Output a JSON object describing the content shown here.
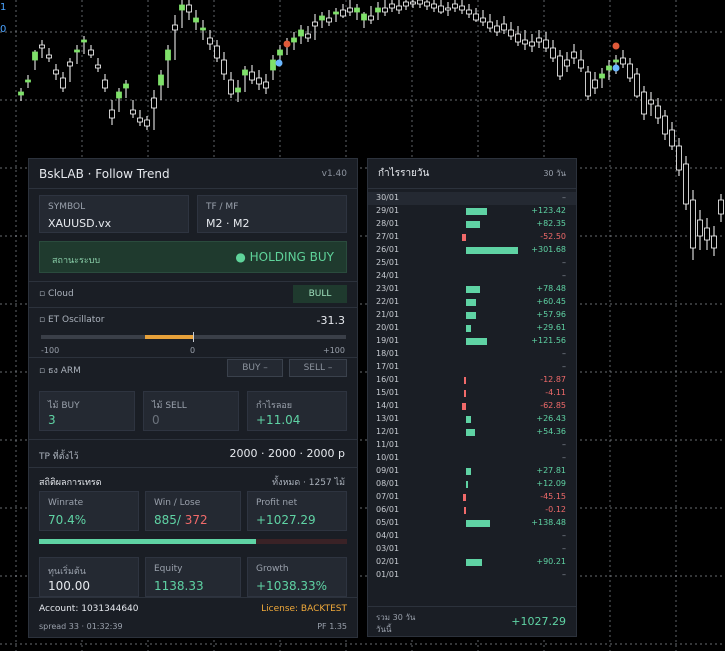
{
  "axis_tags": [
    "1",
    "0"
  ],
  "colors": {
    "bull": "#5fd3a4",
    "bear": "#f06a6a",
    "accent": "#e7a13a",
    "license": "#f0a93a"
  },
  "panel": {
    "title": "BskLAB · Follow Trend",
    "version": "v1.40",
    "symbol_label": "SYMBOL",
    "symbol_value": "XAUUSD.vx",
    "tf_label": "TF / MF",
    "tf_value": "M2 · M2",
    "status_label": "สถานะระบบ",
    "status_value": "● HOLDING BUY",
    "cloud_label": "▫ Cloud",
    "cloud_value": "BULL",
    "osc_label": "▫ ET Oscillator",
    "osc_value": "-31.3",
    "osc_level": -31.3,
    "osc_min_label": "-100",
    "osc_mid_label": "0",
    "osc_max_label": "+100",
    "arm_label": "▫ ธง ARM",
    "arm_buy": "BUY –",
    "arm_sell": "SELL –",
    "buy_label": "ไม้ BUY",
    "buy_value": "3",
    "sell_label": "ไม้ SELL",
    "sell_value": "0",
    "float_label": "กำไรลอย",
    "float_value": "+11.04",
    "tp_label": "TP ที่ตั้งไว้",
    "tp_value": "2000 · 2000 · 2000 p",
    "stats_title": "สถิติผลการเทรด",
    "stats_total": "ทั้งหมด · 1257 ไม้",
    "winrate_label": "Winrate",
    "winrate_value": "70.4%",
    "winrate_fraction": 0.704,
    "winlose_label": "Win / Lose",
    "win_value": "885/",
    "lose_value": "372",
    "profit_label": "Profit net",
    "profit_value": "+1027.29",
    "capital_label": "ทุนเริ่มต้น",
    "capital_value": "100.00",
    "equity_label": "Equity",
    "equity_value": "1138.33",
    "growth_label": "Growth",
    "growth_value": "+1038.33%",
    "account": "Account: 1031344640",
    "license": "License: BACKTEST",
    "spread": "spread 33 · 01:32:39",
    "pf": "PF 1.35"
  },
  "daily": {
    "title": "กำไรรายวัน",
    "subtitle": "30 วัน",
    "rows": [
      {
        "d": "30/01",
        "v": "–",
        "n": 0
      },
      {
        "d": "29/01",
        "v": "+123.42",
        "n": 123.42
      },
      {
        "d": "28/01",
        "v": "+82.35",
        "n": 82.35
      },
      {
        "d": "27/01",
        "v": "-52.50",
        "n": -52.5
      },
      {
        "d": "26/01",
        "v": "+301.68",
        "n": 301.68
      },
      {
        "d": "25/01",
        "v": "–",
        "n": 0
      },
      {
        "d": "24/01",
        "v": "–",
        "n": 0
      },
      {
        "d": "23/01",
        "v": "+78.48",
        "n": 78.48
      },
      {
        "d": "22/01",
        "v": "+60.45",
        "n": 60.45
      },
      {
        "d": "21/01",
        "v": "+57.96",
        "n": 57.96
      },
      {
        "d": "20/01",
        "v": "+29.61",
        "n": 29.61
      },
      {
        "d": "19/01",
        "v": "+121.56",
        "n": 121.56
      },
      {
        "d": "18/01",
        "v": "–",
        "n": 0
      },
      {
        "d": "17/01",
        "v": "–",
        "n": 0
      },
      {
        "d": "16/01",
        "v": "-12.87",
        "n": -12.87
      },
      {
        "d": "15/01",
        "v": "-4.11",
        "n": -4.11
      },
      {
        "d": "14/01",
        "v": "-62.85",
        "n": -62.85
      },
      {
        "d": "13/01",
        "v": "+26.43",
        "n": 26.43
      },
      {
        "d": "12/01",
        "v": "+54.36",
        "n": 54.36
      },
      {
        "d": "11/01",
        "v": "–",
        "n": 0
      },
      {
        "d": "10/01",
        "v": "–",
        "n": 0
      },
      {
        "d": "09/01",
        "v": "+27.81",
        "n": 27.81
      },
      {
        "d": "08/01",
        "v": "+12.09",
        "n": 12.09
      },
      {
        "d": "07/01",
        "v": "-45.15",
        "n": -45.15
      },
      {
        "d": "06/01",
        "v": "-0.12",
        "n": -0.12
      },
      {
        "d": "05/01",
        "v": "+138.48",
        "n": 138.48
      },
      {
        "d": "04/01",
        "v": "–",
        "n": 0
      },
      {
        "d": "03/01",
        "v": "–",
        "n": 0
      },
      {
        "d": "02/01",
        "v": "+90.21",
        "n": 90.21
      },
      {
        "d": "01/01",
        "v": "–",
        "n": 0
      }
    ],
    "total_label": "รวม 30 วัน",
    "today_label": "วันนี้",
    "total_value": "+1027.29"
  },
  "candles": [
    [
      21,
      95,
      101,
      88,
      92
    ],
    [
      28,
      82,
      88,
      75,
      80
    ],
    [
      35,
      60,
      70,
      50,
      52
    ],
    [
      42,
      45,
      58,
      40,
      48
    ],
    [
      49,
      55,
      62,
      48,
      58
    ],
    [
      56,
      70,
      80,
      64,
      74
    ],
    [
      63,
      78,
      92,
      72,
      88
    ],
    [
      70,
      62,
      82,
      58,
      66
    ],
    [
      77,
      52,
      64,
      45,
      50
    ],
    [
      84,
      42,
      54,
      36,
      40
    ],
    [
      91,
      50,
      58,
      45,
      55
    ],
    [
      98,
      65,
      72,
      58,
      68
    ],
    [
      105,
      80,
      92,
      74,
      88
    ],
    [
      112,
      110,
      125,
      100,
      118
    ],
    [
      119,
      98,
      112,
      88,
      92
    ],
    [
      126,
      88,
      98,
      80,
      84
    ],
    [
      133,
      110,
      118,
      100,
      114
    ],
    [
      140,
      118,
      126,
      110,
      122
    ],
    [
      147,
      120,
      130,
      116,
      126
    ],
    [
      154,
      98,
      130,
      90,
      108
    ],
    [
      161,
      85,
      100,
      70,
      75
    ],
    [
      168,
      60,
      88,
      45,
      50
    ],
    [
      175,
      25,
      60,
      15,
      30
    ],
    [
      182,
      10,
      28,
      0,
      5
    ],
    [
      189,
      5,
      20,
      0,
      12
    ],
    [
      196,
      22,
      30,
      10,
      18
    ],
    [
      203,
      30,
      40,
      20,
      28
    ],
    [
      210,
      38,
      50,
      30,
      44
    ],
    [
      217,
      46,
      62,
      40,
      58
    ],
    [
      224,
      60,
      80,
      52,
      74
    ],
    [
      231,
      80,
      98,
      72,
      94
    ],
    [
      238,
      92,
      102,
      80,
      88
    ],
    [
      245,
      75,
      92,
      66,
      70
    ],
    [
      252,
      72,
      84,
      65,
      80
    ],
    [
      259,
      78,
      90,
      70,
      84
    ],
    [
      266,
      82,
      94,
      74,
      88
    ],
    [
      273,
      70,
      80,
      55,
      60
    ],
    [
      280,
      55,
      65,
      45,
      50
    ],
    [
      287,
      45,
      55,
      38,
      42
    ],
    [
      294,
      42,
      50,
      32,
      38
    ],
    [
      301,
      36,
      44,
      25,
      30
    ],
    [
      308,
      34,
      42,
      26,
      38
    ],
    [
      315,
      22,
      40,
      14,
      26
    ],
    [
      322,
      20,
      28,
      12,
      16
    ],
    [
      329,
      18,
      26,
      10,
      22
    ],
    [
      336,
      14,
      22,
      8,
      12
    ],
    [
      343,
      10,
      18,
      4,
      16
    ],
    [
      350,
      8,
      16,
      0,
      12
    ],
    [
      357,
      12,
      20,
      4,
      8
    ],
    [
      364,
      20,
      28,
      12,
      14
    ],
    [
      371,
      16,
      24,
      6,
      20
    ],
    [
      378,
      12,
      20,
      2,
      8
    ],
    [
      385,
      8,
      16,
      0,
      12
    ],
    [
      392,
      4,
      12,
      0,
      8
    ],
    [
      399,
      6,
      14,
      0,
      10
    ],
    [
      406,
      2,
      10,
      0,
      6
    ],
    [
      413,
      2,
      8,
      0,
      4
    ],
    [
      420,
      0,
      8,
      0,
      4
    ],
    [
      427,
      2,
      10,
      0,
      6
    ],
    [
      434,
      4,
      12,
      0,
      8
    ],
    [
      441,
      6,
      14,
      0,
      12
    ],
    [
      448,
      8,
      16,
      2,
      10
    ],
    [
      455,
      4,
      12,
      0,
      8
    ],
    [
      462,
      6,
      14,
      0,
      10
    ],
    [
      469,
      10,
      18,
      4,
      14
    ],
    [
      476,
      14,
      22,
      8,
      20
    ],
    [
      483,
      18,
      26,
      10,
      22
    ],
    [
      490,
      22,
      32,
      14,
      28
    ],
    [
      497,
      26,
      36,
      20,
      32
    ],
    [
      504,
      24,
      34,
      16,
      30
    ],
    [
      511,
      30,
      40,
      22,
      36
    ],
    [
      518,
      34,
      46,
      26,
      42
    ],
    [
      525,
      40,
      50,
      30,
      44
    ],
    [
      532,
      42,
      52,
      34,
      46
    ],
    [
      539,
      38,
      48,
      30,
      42
    ],
    [
      546,
      40,
      52,
      32,
      48
    ],
    [
      553,
      48,
      62,
      40,
      58
    ],
    [
      560,
      56,
      80,
      50,
      76
    ],
    [
      567,
      60,
      72,
      52,
      66
    ],
    [
      574,
      52,
      64,
      44,
      58
    ],
    [
      581,
      60,
      72,
      50,
      68
    ],
    [
      588,
      72,
      100,
      66,
      96
    ],
    [
      595,
      80,
      94,
      72,
      88
    ],
    [
      602,
      78,
      88,
      68,
      74
    ],
    [
      609,
      70,
      80,
      60,
      66
    ],
    [
      616,
      62,
      74,
      55,
      60
    ],
    [
      623,
      58,
      68,
      50,
      64
    ],
    [
      630,
      64,
      82,
      58,
      78
    ],
    [
      637,
      74,
      98,
      68,
      96
    ],
    [
      644,
      92,
      120,
      86,
      114
    ],
    [
      651,
      100,
      116,
      92,
      104
    ],
    [
      658,
      106,
      124,
      98,
      118
    ],
    [
      665,
      116,
      140,
      110,
      134
    ],
    [
      672,
      130,
      150,
      122,
      146
    ],
    [
      679,
      146,
      176,
      138,
      170
    ],
    [
      686,
      164,
      210,
      156,
      204
    ],
    [
      693,
      200,
      260,
      190,
      248
    ],
    [
      700,
      220,
      250,
      210,
      236
    ],
    [
      707,
      228,
      250,
      218,
      240
    ],
    [
      714,
      236,
      256,
      226,
      248
    ],
    [
      721,
      200,
      222,
      194,
      214
    ]
  ]
}
